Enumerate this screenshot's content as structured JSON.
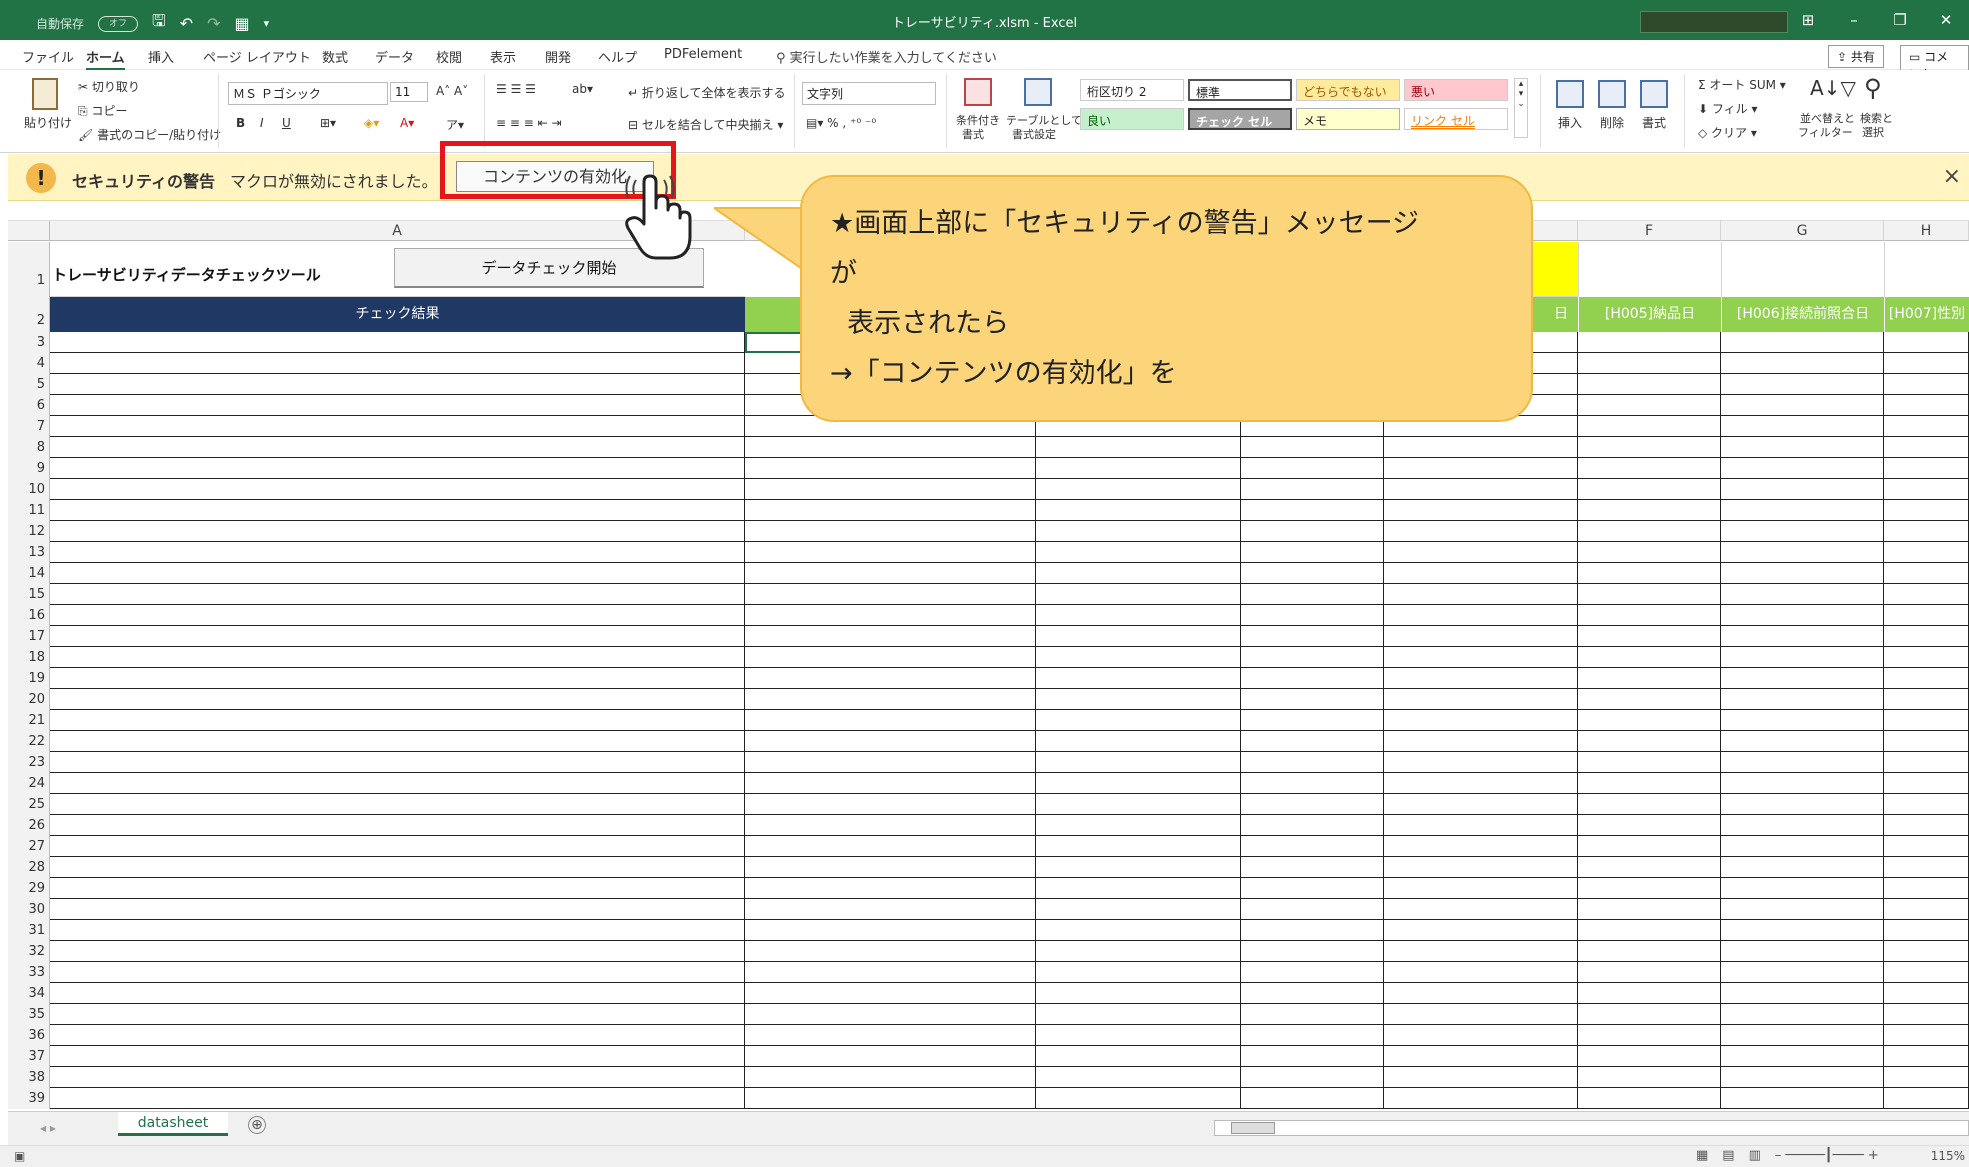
{
  "titlebar": {
    "autosave_label": "自動保存",
    "autosave_state": "オフ",
    "window_title": "トレーサビリティ.xlsm  -  Excel",
    "qat_icons": [
      "save-icon",
      "undo-icon",
      "redo-icon",
      "preview-icon",
      "customize-icon"
    ]
  },
  "tabs": [
    {
      "label": "ファイル"
    },
    {
      "label": "ホーム",
      "active": true
    },
    {
      "label": "挿入"
    },
    {
      "label": "ページ レイアウト"
    },
    {
      "label": "数式"
    },
    {
      "label": "データ"
    },
    {
      "label": "校閲"
    },
    {
      "label": "表示"
    },
    {
      "label": "開発"
    },
    {
      "label": "ヘルプ"
    },
    {
      "label": "PDFelement"
    }
  ],
  "tellme": "実行したい作業を入力してください",
  "share_label": "共有",
  "comment_label": "コメント",
  "ribbon": {
    "paste": "貼り付け",
    "cut": "切り取り",
    "copy": "コピー",
    "format_painter": "書式のコピー/貼り付け",
    "font_name": "ＭＳ Ｐゴシック",
    "font_size": "11",
    "bold": "B",
    "italic": "I",
    "underline": "U",
    "wrap_text": "折り返して全体を表示する",
    "merge_center": "セルを結合して中央揃え",
    "number_format": "文字列",
    "conditional": "条件付き",
    "conditional2": "書式",
    "as_table": "テーブルとして",
    "as_table2": "書式設定",
    "styles": [
      {
        "label": "桁区切り 2",
        "bg": "#ffffff",
        "fg": "#222222"
      },
      {
        "label": "標準",
        "bg": "#ffffff",
        "fg": "#222222"
      },
      {
        "label": "どちらでもない",
        "bg": "#ffeb9c",
        "fg": "#9c5700"
      },
      {
        "label": "悪い",
        "bg": "#ffc7ce",
        "fg": "#9c0006"
      },
      {
        "label": "良い",
        "bg": "#c6efce",
        "fg": "#006100"
      },
      {
        "label": "チェック セル",
        "bg": "#a5a5a5",
        "fg": "#ffffff"
      },
      {
        "label": "メモ",
        "bg": "#ffffcc",
        "fg": "#222222"
      },
      {
        "label": "リンク セル",
        "bg": "#ffffff",
        "fg": "#fa7d00"
      }
    ],
    "insert": "挿入",
    "delete": "削除",
    "format": "書式",
    "autosum": "オート SUM",
    "fill": "フィル",
    "clear": "クリア",
    "sort_filter": "並べ替えと",
    "sort_filter2": "フィルター",
    "find_select": "検索と",
    "find_select2": "選択"
  },
  "security_bar": {
    "title": "セキュリティの警告",
    "message": "マクロが無効にされました。",
    "enable_button": "コンテンツの有効化",
    "close": "×"
  },
  "sheet": {
    "columns": [
      "A",
      "",
      "",
      "",
      "",
      "F",
      "G",
      "H"
    ],
    "tool_title": "トレーサビリティデータチェックツール",
    "start_button": "データチェック開始",
    "header_a": "チェック結果",
    "header_e_partial": "日",
    "header_f": "[H005]納品日",
    "header_g": "[H006]接続前照合日",
    "header_h": "[H007]性別",
    "row_numbers": [
      "1",
      "2",
      "3",
      "4",
      "5",
      "6",
      "7",
      "8",
      "9",
      "10",
      "11",
      "12",
      "13",
      "14",
      "15",
      "16",
      "17",
      "18",
      "19",
      "20",
      "21",
      "22",
      "23",
      "24",
      "25",
      "26",
      "27",
      "28",
      "29",
      "30",
      "31",
      "32",
      "33",
      "34",
      "35",
      "36",
      "37",
      "38",
      "39"
    ]
  },
  "callout": {
    "text": "★画面上部に「セキュリティの警告」メッセージ\nが\n  表示されたら\n→「コンテンツの有効化」を"
  },
  "sheet_tab": "datasheet",
  "add_sheet": "⊕",
  "zoom": "115%",
  "colors": {
    "excel_green": "#217346",
    "header_navy": "#1f3864",
    "header_green": "#92d050",
    "yellow_fill": "#ffff00",
    "highlight_red": "#e8141c",
    "callout_fill": "#fcd47a"
  }
}
